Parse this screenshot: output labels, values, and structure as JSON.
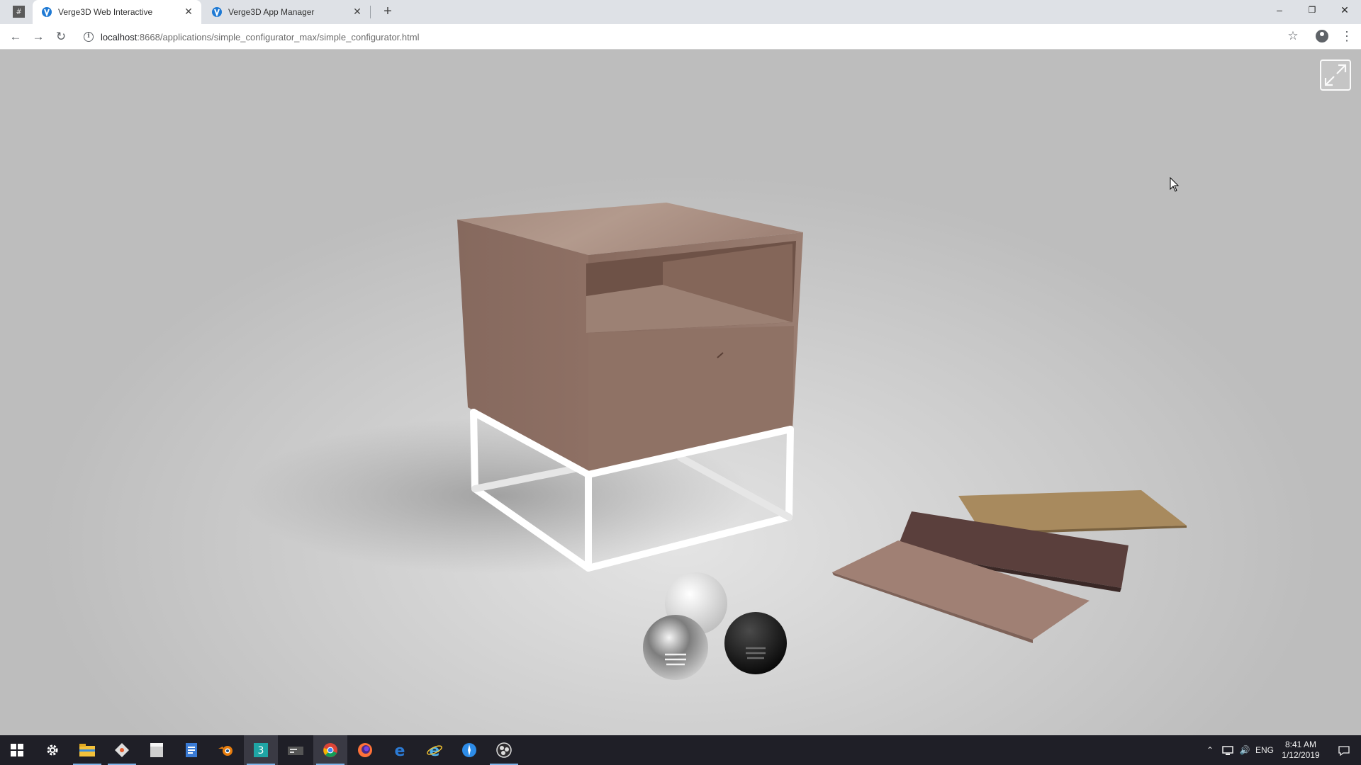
{
  "browser": {
    "tabs": [
      {
        "title": "Verge3D Web Interactive",
        "active": true
      },
      {
        "title": "Verge3D App Manager",
        "active": false
      }
    ],
    "pinned_tab_glyph": "#",
    "new_tab_glyph": "+",
    "window_controls": {
      "minimize": "–",
      "maximize": "❐",
      "close": "✕"
    },
    "url": {
      "host": "localhost",
      "path": ":8668/applications/simple_configurator_max/simple_configurator.html"
    }
  },
  "scene": {
    "nightstand_wood_color": "#9a7e72",
    "frame_color": "#ffffff",
    "wood_swatches": [
      {
        "name": "light-oak",
        "color": "#a88a5e"
      },
      {
        "name": "dark-walnut",
        "color": "#5a3f3c"
      },
      {
        "name": "gray-oak",
        "color": "#a08074"
      }
    ],
    "metal_swatches": [
      {
        "name": "white",
        "color": "#e8e8e8"
      },
      {
        "name": "chrome",
        "color": "#9a9a9a"
      },
      {
        "name": "black",
        "color": "#151515"
      }
    ]
  },
  "taskbar": {
    "apps": [
      {
        "icon": "windows-start-icon"
      },
      {
        "icon": "settings-icon"
      },
      {
        "icon": "file-explorer-icon"
      },
      {
        "icon": "git-icon"
      },
      {
        "icon": "notes-icon"
      },
      {
        "icon": "document-icon"
      },
      {
        "icon": "blender-icon"
      },
      {
        "icon": "3ds-max-icon"
      },
      {
        "icon": "terminal-icon"
      },
      {
        "icon": "chrome-icon"
      },
      {
        "icon": "firefox-icon"
      },
      {
        "icon": "edge-icon"
      },
      {
        "icon": "internet-explorer-icon"
      },
      {
        "icon": "safari-icon"
      },
      {
        "icon": "obs-icon"
      }
    ],
    "language": "ENG",
    "time": "8:41 AM",
    "date": "1/12/2019"
  }
}
